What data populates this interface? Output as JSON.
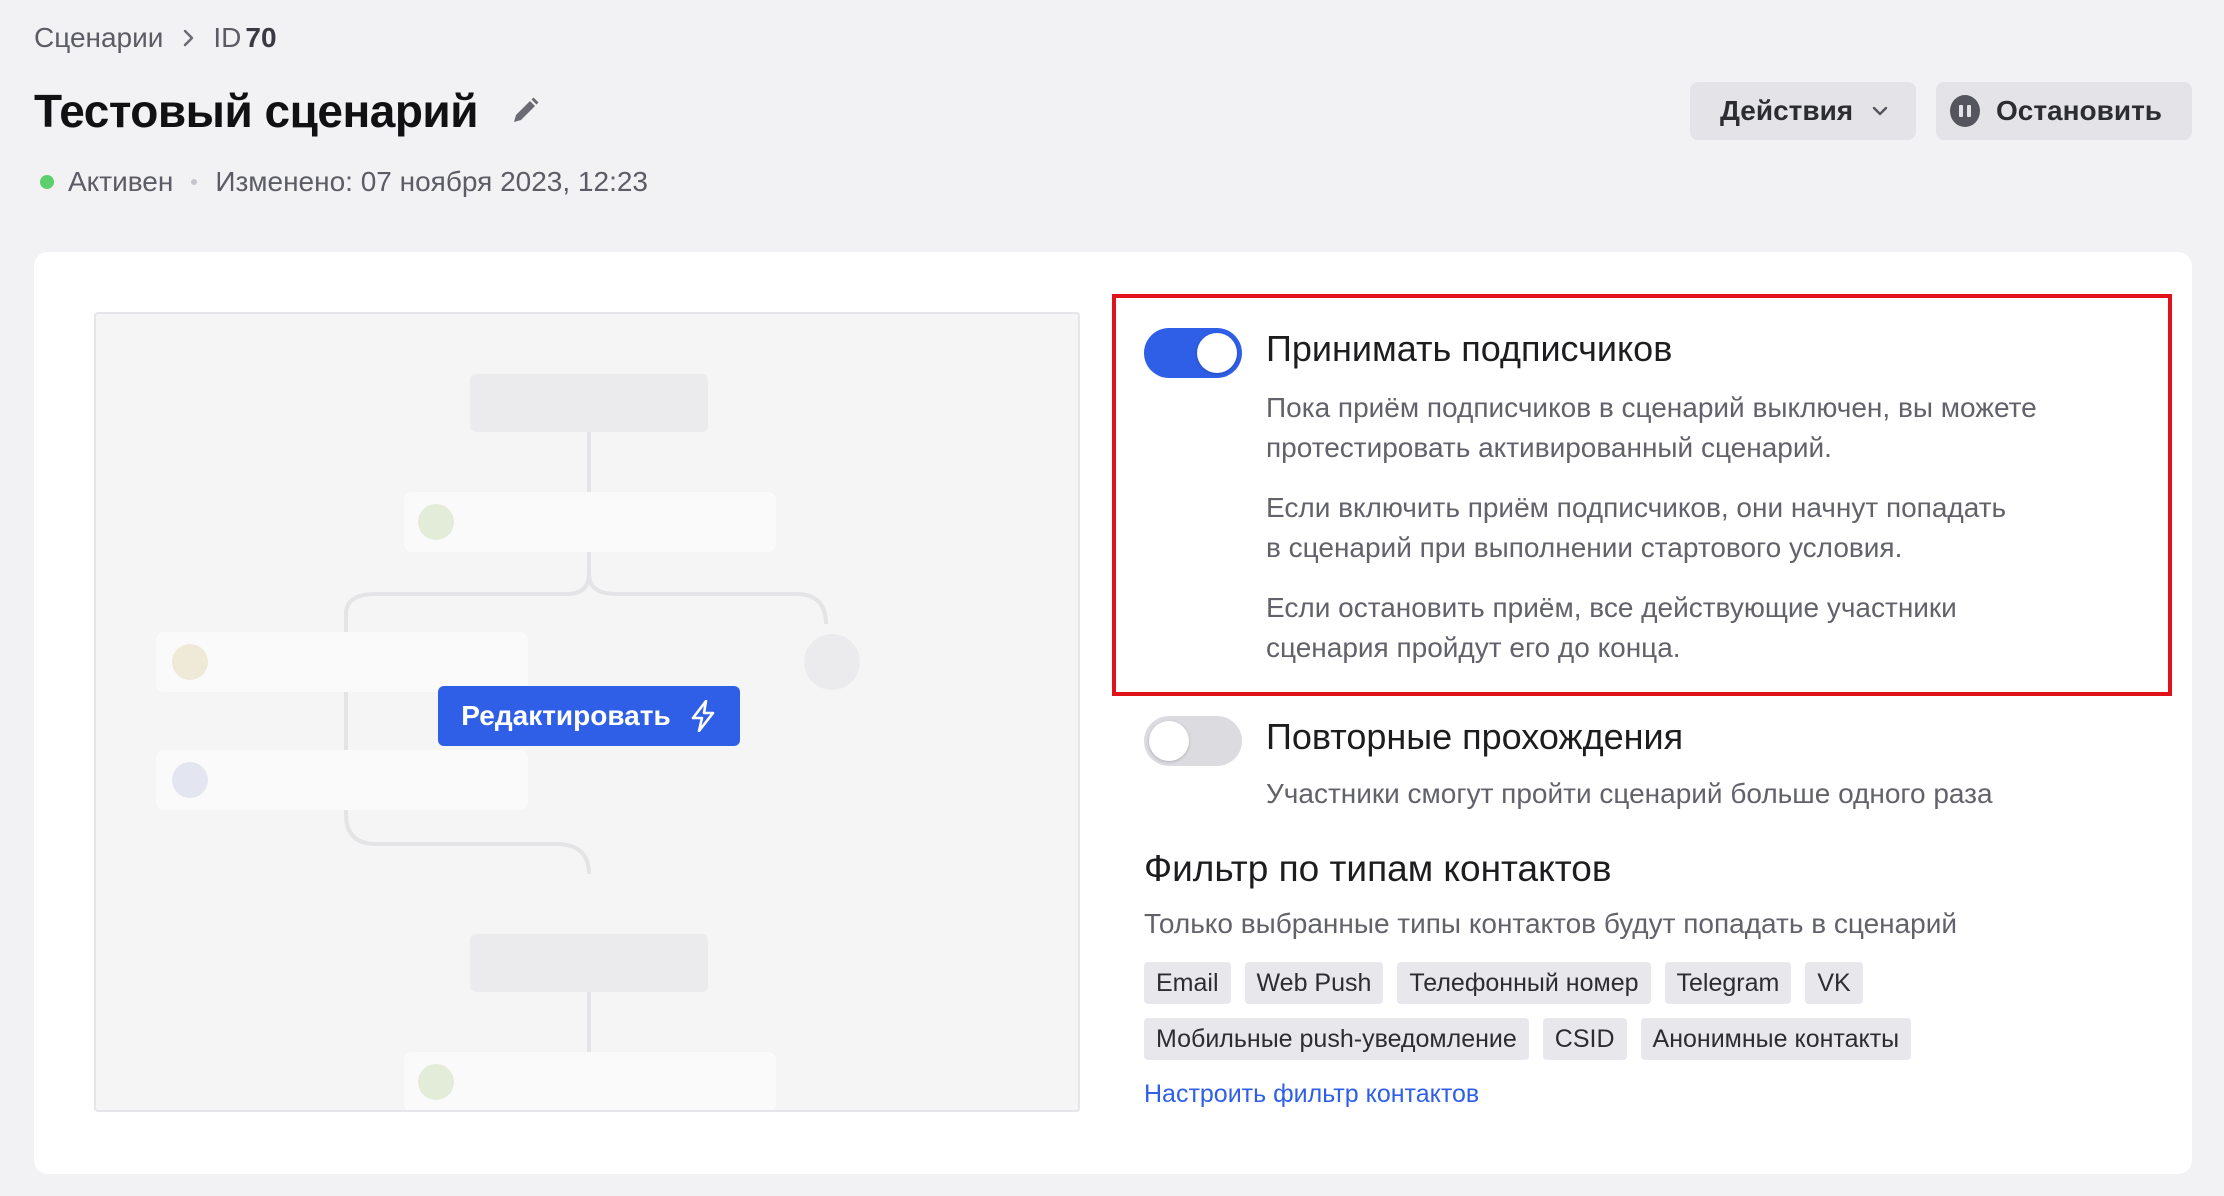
{
  "breadcrumb": {
    "root": "Сценарии",
    "id_prefix": "ID",
    "id_value": "70"
  },
  "header": {
    "title": "Тестовый сценарий",
    "status": "Активен",
    "modified": "Изменено: 07 ноября 2023, 12:23",
    "actions_label": "Действия",
    "stop_label": "Остановить"
  },
  "preview": {
    "edit_label": "Редактировать"
  },
  "settings": {
    "accept": {
      "title": "Принимать подписчиков",
      "enabled": true,
      "desc1_line1": "Пока приём подписчиков в сценарий выключен, вы можете",
      "desc1_line2": "протестировать активированный сценарий.",
      "desc2_line1": "Если включить приём подписчиков, они начнут попадать",
      "desc2_line2": "в сценарий при выполнении стартового условия.",
      "desc3_line1": "Если остановить приём, все действующие участники",
      "desc3_line2": "сценария пройдут его до конца."
    },
    "repeat": {
      "title": "Повторные прохождения",
      "enabled": false,
      "desc": "Участники смогут пройти сценарий больше одного раза"
    },
    "filter": {
      "title": "Фильтр по типам контактов",
      "desc": "Только выбранные типы контактов будут попадать в сценарий",
      "chips": [
        "Email",
        "Web Push",
        "Телефонный номер",
        "Telegram",
        "VK",
        "Мобильные push-уведомление",
        "CSID",
        "Анонимные контакты"
      ],
      "link": "Настроить фильтр контактов"
    }
  },
  "colors": {
    "accent": "#2f5fe6",
    "status_active": "#5ccf6e",
    "highlight": "#e0121a"
  },
  "icons": {
    "breadcrumb_separator": "chevron-right-icon",
    "title_edit": "pencil-icon",
    "actions": "chevron-down-icon",
    "stop": "pause-icon",
    "edit": "bolt-icon"
  }
}
